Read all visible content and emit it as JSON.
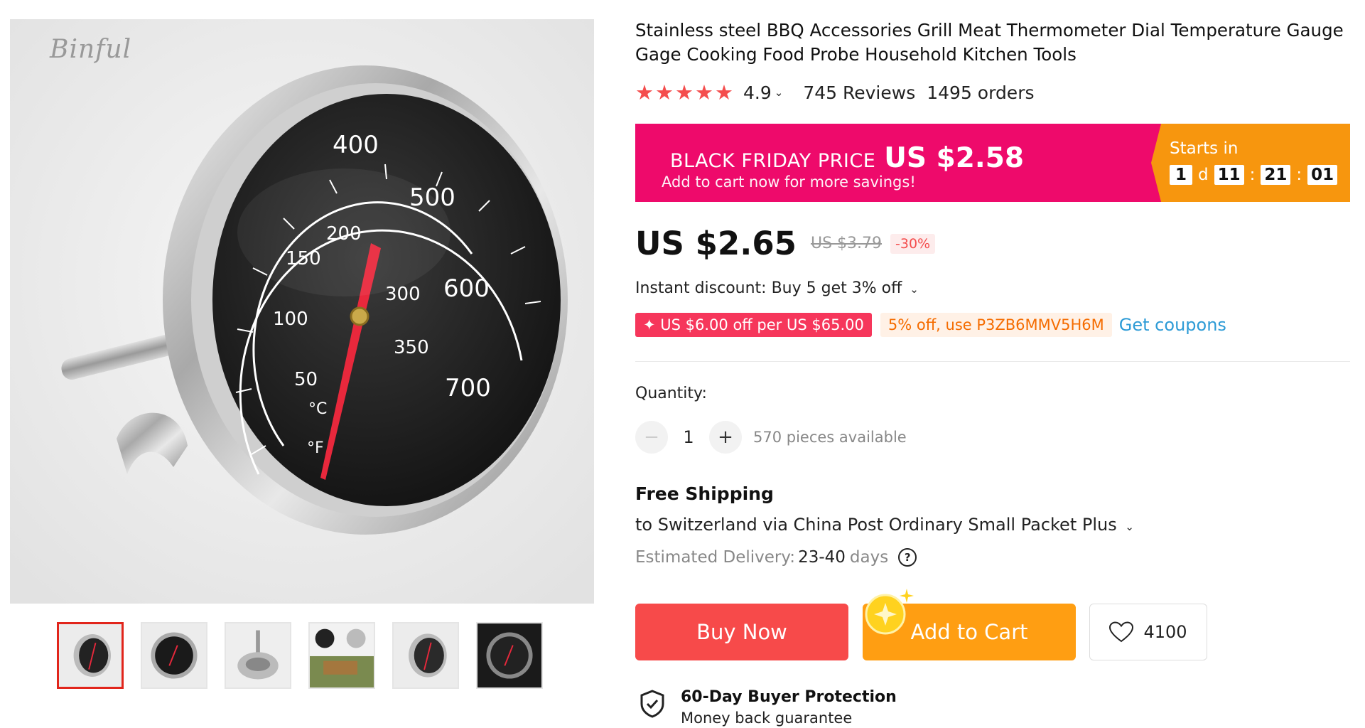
{
  "gallery": {
    "watermark": "Binful",
    "dial_labels": [
      "400",
      "500",
      "600",
      "700",
      "200",
      "150",
      "100",
      "50",
      "300",
      "350",
      "°C",
      "°F"
    ],
    "thumbnails": [
      "thumbnail-1",
      "thumbnail-2",
      "thumbnail-3",
      "thumbnail-4",
      "thumbnail-5",
      "thumbnail-6"
    ]
  },
  "product": {
    "title": "Stainless steel BBQ Accessories Grill Meat Thermometer Dial Temperature Gauge Gage Cooking Food Probe Household Kitchen Tools",
    "stars": "★★★★★",
    "rating": "4.9",
    "reviews": "745 Reviews",
    "orders": "1495 orders"
  },
  "black_friday": {
    "label": "BLACK FRIDAY PRICE",
    "price": "US $2.58",
    "subtitle": "Add to cart now for more savings!",
    "starts_in": "Starts in",
    "days": "1",
    "days_unit": "d",
    "hours": "11",
    "minutes": "21",
    "seconds": "01"
  },
  "pricing": {
    "price": "US $2.65",
    "original_price": "US $3.79",
    "discount": "-30%",
    "instant_discount": "Instant discount: Buy 5 get 3% off",
    "coupon_store": "✦ US $6.00 off per US $65.00",
    "coupon_code": "5% off, use P3ZB6MMV5H6M",
    "get_coupons": "Get coupons"
  },
  "quantity": {
    "label": "Quantity:",
    "minus": "−",
    "value": "1",
    "plus": "+",
    "available": "570 pieces available"
  },
  "shipping": {
    "title": "Free Shipping",
    "route": "to Switzerland via China Post Ordinary Small Packet Plus",
    "delivery_label": "Estimated Delivery:",
    "delivery_range": "23-40",
    "delivery_unit": "days",
    "help": "?"
  },
  "actions": {
    "buy_now": "Buy Now",
    "add_to_cart": "Add to Cart",
    "wishlist_count": "4100"
  },
  "protection": {
    "title": "60-Day Buyer Protection",
    "subtitle": "Money back guarantee"
  },
  "colors": {
    "accent_red": "#f74a4a",
    "accent_orange": "#ff9e12",
    "black_friday_pink": "#ee0a6b",
    "link_blue": "#2d9bd6"
  }
}
